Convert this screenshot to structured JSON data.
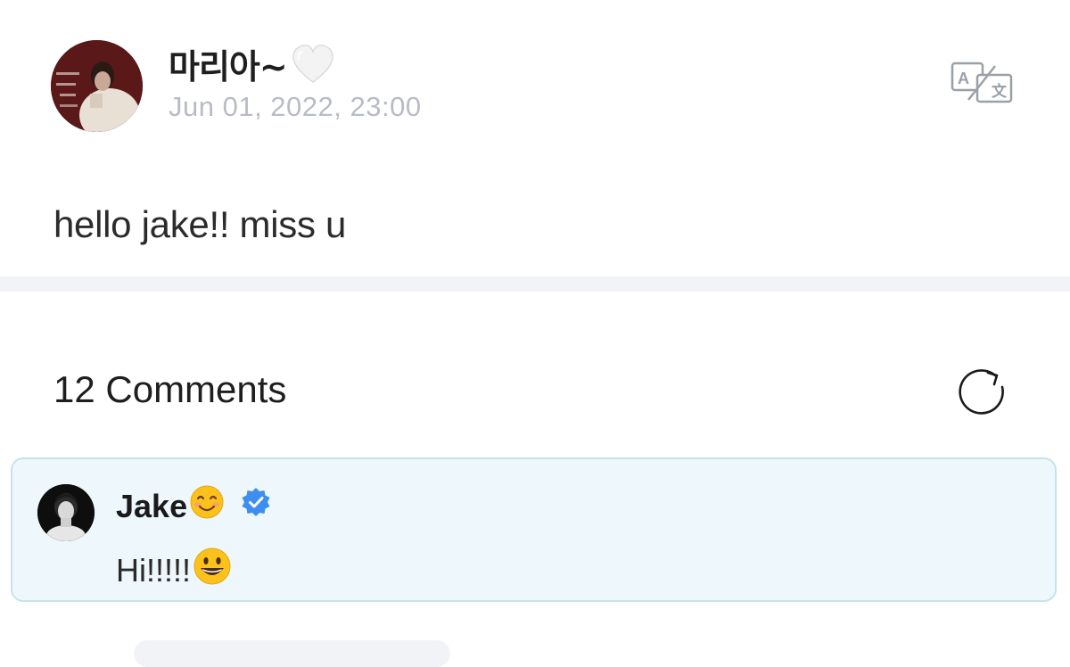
{
  "post": {
    "author": "마리아~",
    "author_heart_icon": "white-heart-icon",
    "date": "Jun 01, 2022, 23:00",
    "body": "hello jake!! miss u",
    "translate_icon": "translate-icon"
  },
  "comments": {
    "title": "12 Comments",
    "refresh_icon": "refresh-icon",
    "items": [
      {
        "author": "Jake",
        "author_emoji": "smiling-face-icon",
        "verified_icon": "verified-badge-icon",
        "text": "Hi!!!!!",
        "text_emoji": "grinning-face-icon"
      }
    ]
  },
  "colors": {
    "date_text": "#b8bcc4",
    "comment_bg": "#eef8fc",
    "comment_border": "#c6e3ec",
    "verified_blue": "#3d8ef0",
    "divider": "#f2f3f6"
  }
}
